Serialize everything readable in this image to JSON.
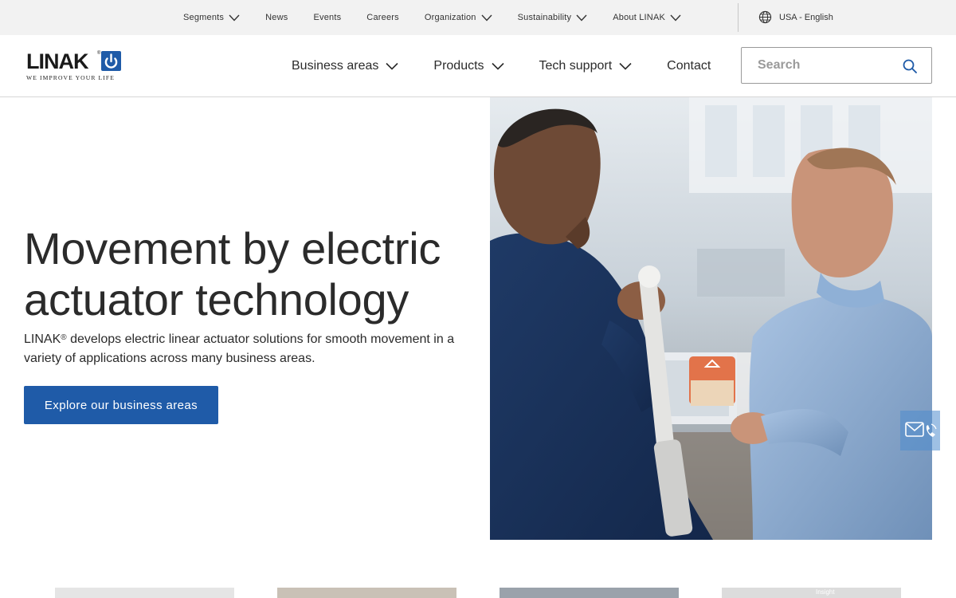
{
  "utility_nav": {
    "items": [
      {
        "label": "Segments",
        "dropdown": true
      },
      {
        "label": "News",
        "dropdown": false
      },
      {
        "label": "Events",
        "dropdown": false
      },
      {
        "label": "Careers",
        "dropdown": false
      },
      {
        "label": "Organization",
        "dropdown": true
      },
      {
        "label": "Sustainability",
        "dropdown": true
      },
      {
        "label": "About LINAK",
        "dropdown": true
      }
    ],
    "locale": {
      "label": "USA - English",
      "icon": "globe-icon"
    }
  },
  "brand": {
    "name": "LINAK",
    "tagline": "WE IMPROVE YOUR LIFE",
    "logo_color": "#1f5ba8"
  },
  "main_nav": {
    "items": [
      {
        "label": "Business areas",
        "dropdown": true
      },
      {
        "label": "Products",
        "dropdown": true
      },
      {
        "label": "Tech support",
        "dropdown": true
      },
      {
        "label": "Contact",
        "dropdown": false
      }
    ]
  },
  "search": {
    "placeholder": "Search",
    "value": "",
    "icon": "search-icon"
  },
  "hero": {
    "title": "Movement by electric actuator technology",
    "subtitle_brand": "LINAK",
    "subtitle_reg": "®",
    "subtitle_text": " develops electric linear actuator solutions for smooth movement in a variety of applications across many business areas.",
    "cta_label": "Explore our business areas",
    "image_alt": "Two men examining an electric linear actuator"
  },
  "contact_widget": {
    "icon": "mail-phone-icon"
  },
  "cards": [
    {
      "label": ""
    },
    {
      "label": ""
    },
    {
      "label": ""
    },
    {
      "label": "Insight"
    }
  ],
  "colors": {
    "accent": "#1f5ba8",
    "utility_bar_bg": "#f2f2f2",
    "text": "#2b2b2b"
  }
}
